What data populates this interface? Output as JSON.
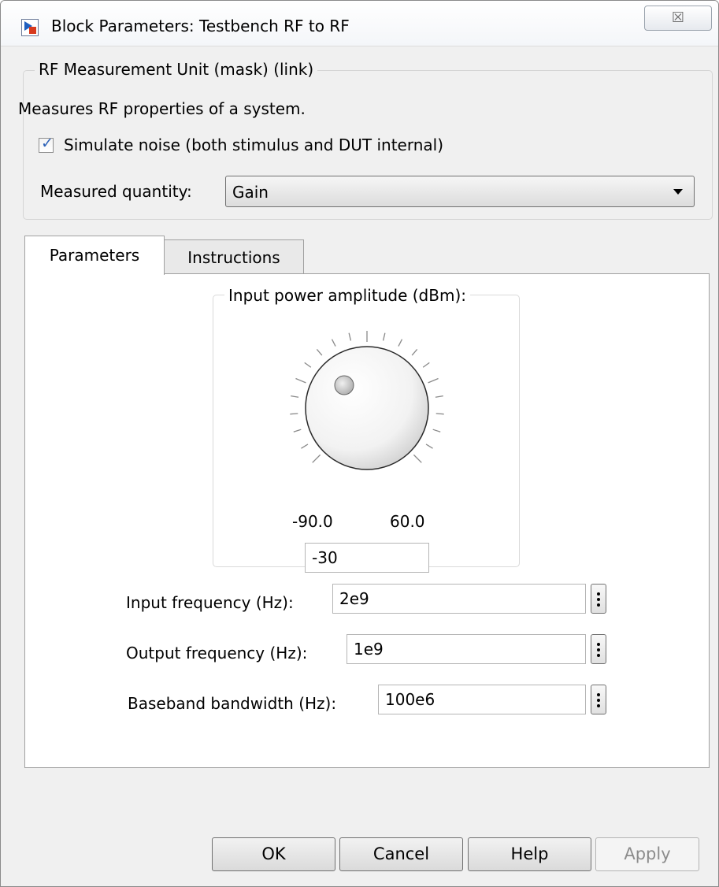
{
  "window": {
    "title": "Block Parameters: Testbench RF to RF",
    "close_glyph": "☒"
  },
  "mask": {
    "group_title": "RF Measurement Unit (mask) (link)",
    "description": "Measures RF properties of a system.",
    "simulate_noise_label": "Simulate noise (both stimulus and DUT internal)",
    "simulate_noise_checked": true,
    "measured_quantity_label": "Measured quantity:",
    "measured_quantity_value": "Gain"
  },
  "tabs": [
    {
      "label": "Parameters",
      "active": true
    },
    {
      "label": "Instructions",
      "active": false
    }
  ],
  "knob": {
    "title": "Input power amplitude (dBm):",
    "min_label": "-90.0",
    "max_label": "60.0",
    "value": "-30"
  },
  "params": [
    {
      "label": "Input frequency (Hz):",
      "value": "2e9"
    },
    {
      "label": "Output frequency (Hz):",
      "value": "1e9"
    },
    {
      "label": "Baseband bandwidth (Hz):",
      "value": "100e6"
    }
  ],
  "buttons": {
    "ok": "OK",
    "cancel": "Cancel",
    "help": "Help",
    "apply": "Apply"
  },
  "colors": {
    "check_mark": "#2e63b8",
    "window_bg": "#f0f0f0"
  }
}
